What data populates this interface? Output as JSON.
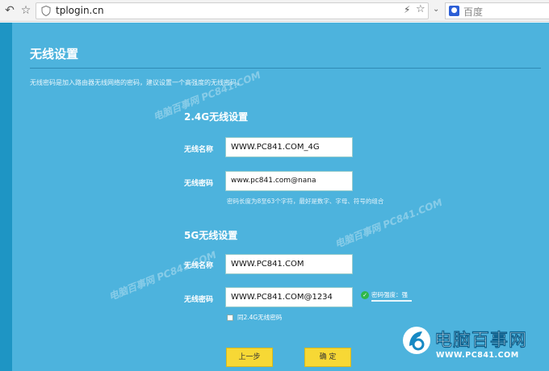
{
  "browser": {
    "url": "tplogin.cn",
    "search_placeholder": "百度",
    "back_icon": "back-arrow-icon",
    "bookmark_icon": "star-icon"
  },
  "page": {
    "title": "无线设置",
    "description": "无线密码是加入路由器无线网络的密码，建议设置一个高强度的无线密码。",
    "section_24g": {
      "title": "2.4G无线设置",
      "name_label": "无线名称",
      "name_value": "WWW.PC841.COM_4G",
      "password_label": "无线密码",
      "password_value": "www.pc841.com@nana",
      "password_hint": "密码长度为8至63个字符，最好是数字、字母、符号的组合"
    },
    "section_5g": {
      "title": "5G无线设置",
      "name_label": "无线名称",
      "name_value": "WWW.PC841.COM",
      "password_label": "无线密码",
      "password_value": "WWW.PC841.COM@1234",
      "strength_text": "密码强度：强",
      "same_as_24g_label": "同2.4G无线密码",
      "same_as_24g_checked": false
    },
    "buttons": {
      "prev": "上一步",
      "confirm": "确 定"
    },
    "watermark": "电脑百事网 PC841.COM",
    "logo": {
      "cn": "电脑百事网",
      "en": "WWW.PC841.COM"
    },
    "colors": {
      "background": "#1e95c4",
      "panel": "#4db3dd",
      "button": "#f7d835",
      "strength_ok": "#2fb84a"
    }
  }
}
